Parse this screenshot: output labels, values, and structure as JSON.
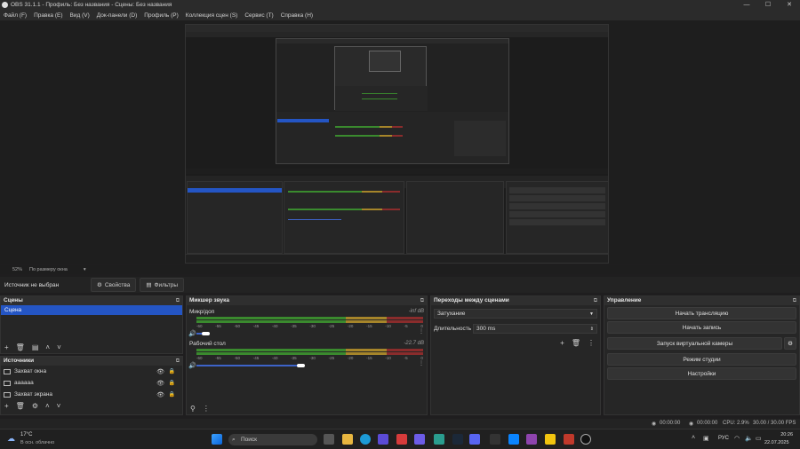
{
  "window": {
    "title": "OBS 31.1.1 - Профиль: Без названия - Сцены: Без названия",
    "minimize": "—",
    "maximize": "☐",
    "close": "✕"
  },
  "menu": [
    "Файл (F)",
    "Правка (E)",
    "Вид (V)",
    "Док-панели (D)",
    "Профиль (P)",
    "Коллекция сцен (S)",
    "Сервис (T)",
    "Справка (H)"
  ],
  "preview": {
    "zoom": "52%",
    "scale_mode": "По размеру окна"
  },
  "source_toolbar": {
    "no_source": "Источник не выбран",
    "properties": "Свойства",
    "filters": "Фильтры"
  },
  "scenes": {
    "title": "Сцены",
    "items": [
      "Сцена"
    ]
  },
  "sources": {
    "title": "Источники",
    "items": [
      "Захват окна",
      "аааааа",
      "Захват экрана"
    ]
  },
  "mixer": {
    "title": "Микшер звука",
    "ticks": [
      "-60",
      "-55",
      "-50",
      "-45",
      "-40",
      "-35",
      "-30",
      "-25",
      "-20",
      "-15",
      "-10",
      "-5",
      "0"
    ],
    "channels": [
      {
        "name": "Микр/доп",
        "db": "-inf dB",
        "level_fraction": 0.0,
        "volume_fraction": 0.03
      },
      {
        "name": "Рабочий стол",
        "db": "-22.7 dB",
        "level_fraction": 0.0,
        "volume_fraction": 0.45
      }
    ]
  },
  "transitions": {
    "title": "Переходы между сценами",
    "type": "Затухание",
    "duration_label": "Длительность",
    "duration_value": "300 ms"
  },
  "controls": {
    "title": "Управление",
    "buttons": [
      "Начать трансляцию",
      "Начать запись",
      "Запуск виртуальной камеры",
      "Режим студии",
      "Настройки"
    ]
  },
  "status": {
    "stream_time": "00:00:00",
    "record_time": "00:00:00",
    "cpu": "CPU: 2.9%",
    "fps": "30.00 / 30.00 FPS"
  },
  "taskbar": {
    "weather_temp": "17°C",
    "weather_desc": "В осн. облачно",
    "search_placeholder": "Поиск",
    "lang": "РУС",
    "time": "20:26",
    "date": "22.07.2025"
  },
  "colors": {
    "accent": "#2455c4",
    "meter_green": "#3a8a2e",
    "meter_yellow": "#a6852a",
    "meter_red": "#8a2c2c"
  }
}
